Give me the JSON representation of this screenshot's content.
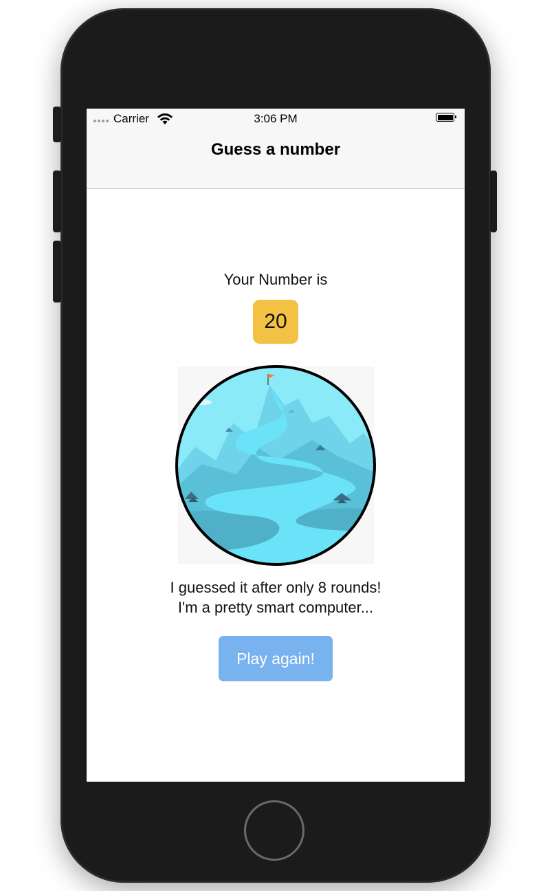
{
  "status_bar": {
    "carrier": "Carrier",
    "time": "3:06 PM",
    "signal_icon": "signal-dots-icon",
    "wifi_icon": "wifi-icon",
    "battery_icon": "battery-icon"
  },
  "nav": {
    "title": "Guess a number"
  },
  "result": {
    "label": "Your Number is",
    "number": "20",
    "message_line1": "I guessed it after only 8 rounds!",
    "message_line2": "I'm a pretty smart computer...",
    "image": "mountain-summit-illustration"
  },
  "actions": {
    "play_again_label": "Play again!"
  },
  "colors": {
    "number_box": "#f3c144",
    "button": "#78b2ef",
    "button_text": "#ffffff",
    "nav_background": "#f7f7f7",
    "phone_body": "#1b1b1b"
  }
}
